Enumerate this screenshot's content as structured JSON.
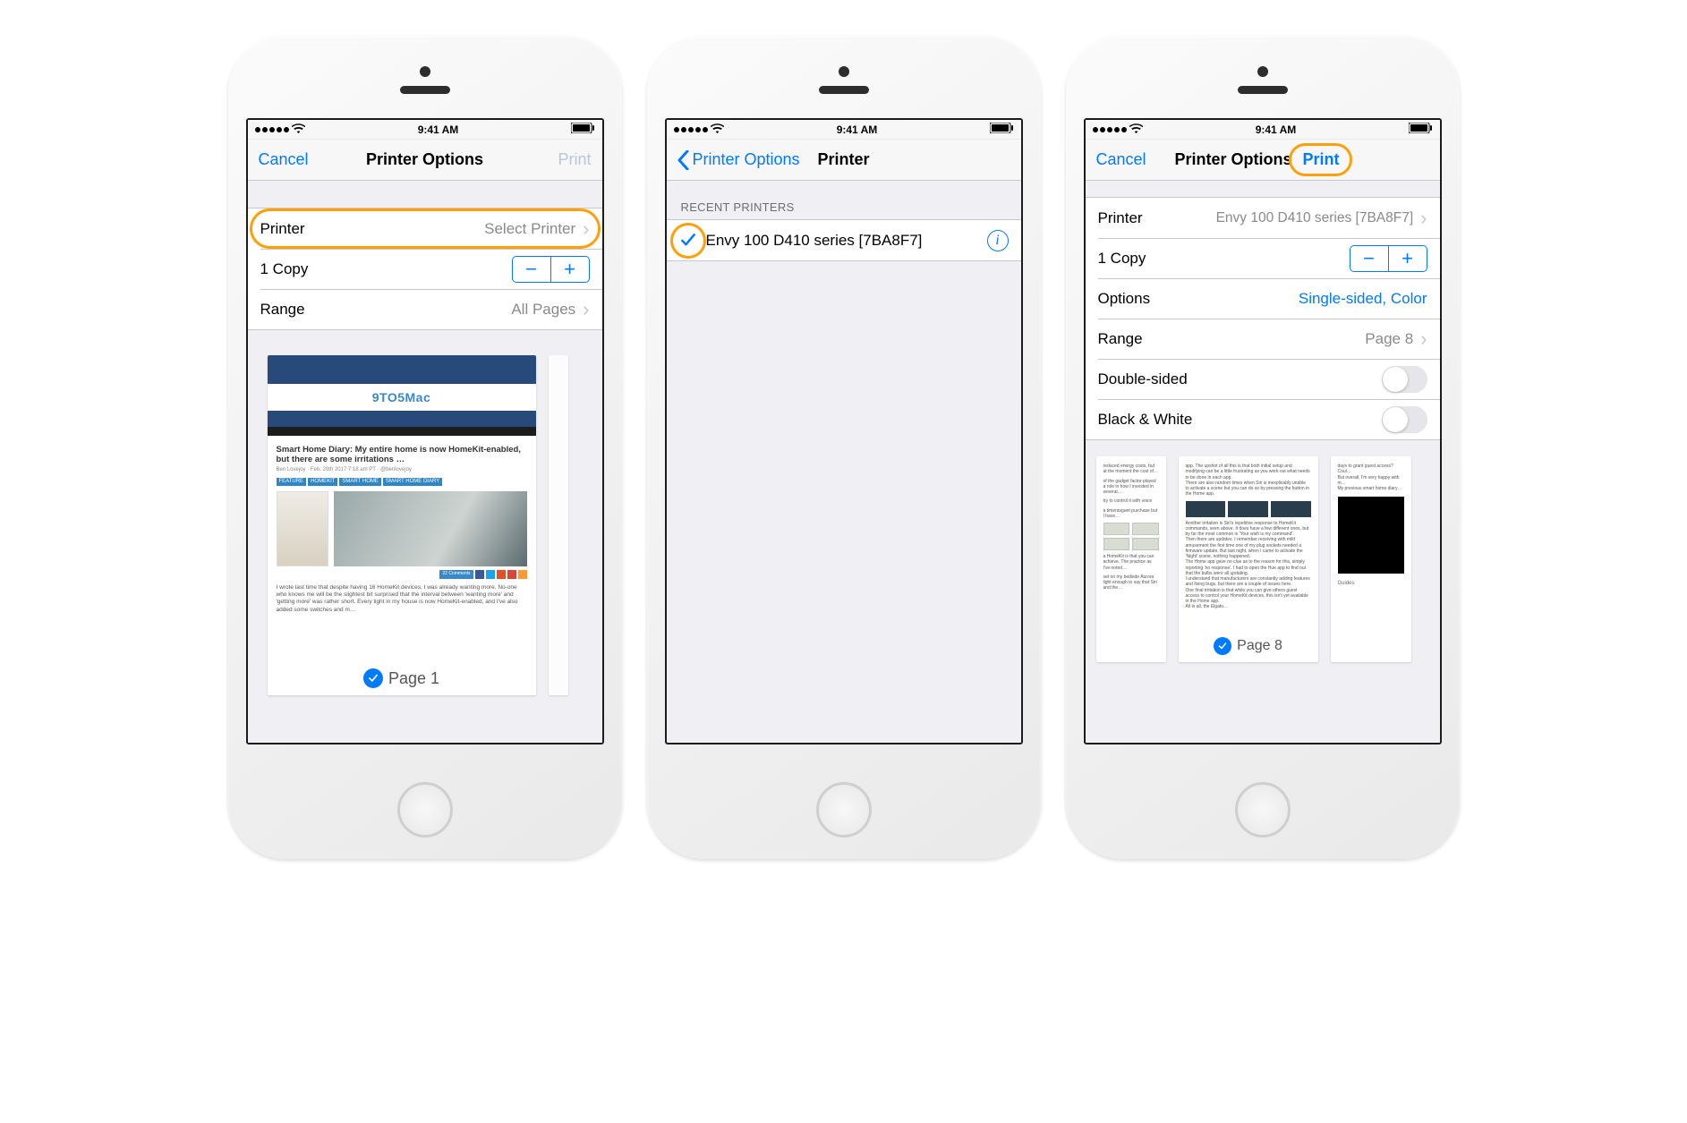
{
  "status": {
    "time": "9:41 AM",
    "battery_icon": "battery",
    "wifi_icon": "wifi"
  },
  "screen1": {
    "nav": {
      "left": "Cancel",
      "title": "Printer Options",
      "right": "Print"
    },
    "rows": {
      "printer": {
        "label": "Printer",
        "value": "Select Printer"
      },
      "copies": {
        "label": "1 Copy"
      },
      "range": {
        "label": "Range",
        "value": "All Pages"
      }
    },
    "preview": {
      "site": "9TO5Mac",
      "article_title": "Smart Home Diary: My entire home is now HomeKit-enabled, but there are some irritations …",
      "byline": "Ben Lovejoy · Feb. 20th 2017 7:18 am PT · @benlovejoy",
      "tags": [
        "FEATURE",
        "HOMEKIT",
        "SMART HOME",
        "SMART HOME DIARY"
      ],
      "para": "I wrote last time that despite having 16 HomeKit devices, I was already wanting more. No-one who knows me will be the slightest bit surprised that the interval between 'wanting more' and 'getting more' was rather short. Every light in my house is now HomeKit-enabled, and I've also added some switches and m…",
      "page_label": "Page 1"
    }
  },
  "screen2": {
    "nav": {
      "back": "Printer Options",
      "title": "Printer"
    },
    "section_header": "RECENT PRINTERS",
    "printer": {
      "name": "Envy 100 D410 series [7BA8F7]"
    }
  },
  "screen3": {
    "nav": {
      "left": "Cancel",
      "title": "Printer Options",
      "right": "Print"
    },
    "rows": {
      "printer": {
        "label": "Printer",
        "value": "Envy 100 D410 series [7BA8F7]"
      },
      "copies": {
        "label": "1 Copy"
      },
      "options": {
        "label": "Options",
        "value": "Single-sided, Color"
      },
      "range": {
        "label": "Range",
        "value": "Page 8"
      },
      "double": {
        "label": "Double-sided"
      },
      "bw": {
        "label": "Black & White"
      }
    },
    "preview": {
      "page_label": "Page 8",
      "guides_label": "Guides"
    }
  }
}
